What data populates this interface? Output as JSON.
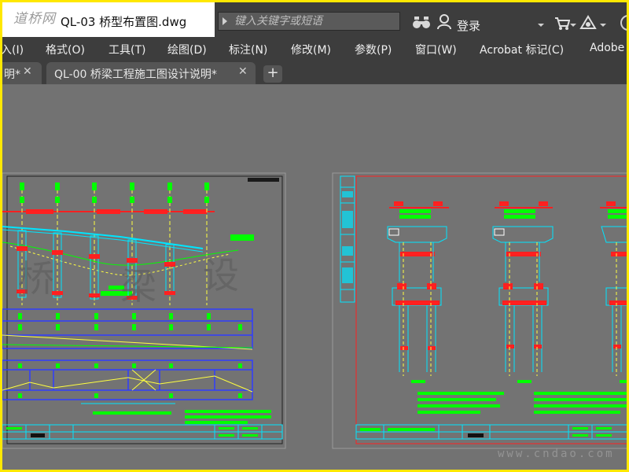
{
  "titlebar": {
    "logo_text": "道桥网",
    "document_title": "QL-03 桥型布置图.dwg",
    "search_placeholder": "键入关键字或短语",
    "login_label": "登录"
  },
  "menubar": {
    "items": [
      "入(I)",
      "格式(O)",
      "工具(T)",
      "绘图(D)",
      "标注(N)",
      "修改(M)",
      "参数(P)",
      "窗口(W)",
      "Acrobat 标记(C)",
      "Adobe"
    ]
  },
  "tabs": [
    {
      "label": "明*"
    },
    {
      "label": "QL-00 桥梁工程施工图设计说明*"
    }
  ],
  "tab_add_label": "+",
  "watermark": "www.cndao.com",
  "colors": {
    "frame": "#ffe800",
    "chrome": "#3d3d3d",
    "canvas": "#727272",
    "cyan": "#00e5ff",
    "green": "#00ff00",
    "red": "#ff2020",
    "blue": "#2f3cff",
    "yellow": "#ffff40"
  },
  "icons": [
    "binoculars-icon",
    "user-icon",
    "cart-icon",
    "exchange-icon",
    "help-icon",
    "close-icon",
    "plus-icon"
  ]
}
